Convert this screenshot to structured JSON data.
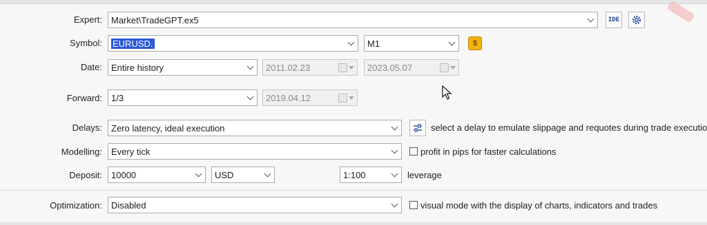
{
  "expert": {
    "label": "Expert:",
    "value": "Market\\TradeGPT.ex5",
    "ide_label": "IDE"
  },
  "symbol": {
    "label": "Symbol:",
    "value": "EURUSD.",
    "timeframe": "M1",
    "symbol_props_icon": "dollar-icon",
    "coin_glyph": "$"
  },
  "date": {
    "label": "Date:",
    "value": "Entire history",
    "from": "2011.02.23",
    "to": "2023.05.07"
  },
  "forward": {
    "label": "Forward:",
    "value": "1/3",
    "date": "2019.04.12"
  },
  "delays": {
    "label": "Delays:",
    "value": "Zero latency, ideal execution",
    "hint": "select a delay to emulate slippage and requotes during trade execution"
  },
  "modelling": {
    "label": "Modelling:",
    "value": "Every tick",
    "checkbox_label": "profit in pips for faster calculations",
    "checked": false
  },
  "deposit": {
    "label": "Deposit:",
    "amount": "10000",
    "currency": "USD",
    "leverage": "1:100",
    "leverage_label": "leverage"
  },
  "optimization": {
    "label": "Optimization:",
    "value": "Disabled",
    "checkbox_label": "visual mode with the display of charts, indicators and trades",
    "checked": false
  }
}
